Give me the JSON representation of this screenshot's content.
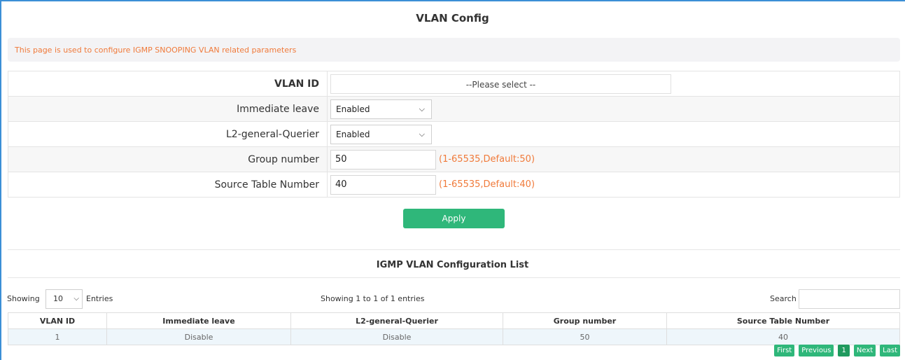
{
  "page": {
    "title": "VLAN Config",
    "notice": "This page is used to configure IGMP SNOOPING VLAN related parameters"
  },
  "form": {
    "vlan_id": {
      "label": "VLAN ID",
      "placeholder": "--Please select --"
    },
    "immediate_leave": {
      "label": "Immediate leave",
      "value": "Enabled"
    },
    "l2_general_querier": {
      "label": "L2-general-Querier",
      "value": "Enabled"
    },
    "group_number": {
      "label": "Group number",
      "value": "50",
      "hint": "(1-65535,Default:50)"
    },
    "source_table_number": {
      "label": "Source Table Number",
      "value": "40",
      "hint": "(1-65535,Default:40)"
    },
    "apply_label": "Apply"
  },
  "list": {
    "title": "IGMP VLAN Configuration List",
    "showing_label": "Showing",
    "entries_value": "10",
    "entries_label": "Entries",
    "info": "Showing 1 to 1 of 1 entries",
    "search_label": "Search",
    "columns": [
      "VLAN ID",
      "Immediate leave",
      "L2-general-Querier",
      "Group number",
      "Source Table Number"
    ],
    "rows": [
      [
        "1",
        "Disable",
        "Disable",
        "50",
        "40"
      ]
    ],
    "pager": {
      "first": "First",
      "previous": "Previous",
      "current": "1",
      "next": "Next",
      "last": "Last"
    }
  },
  "colors": {
    "accent_green": "#2fb77a",
    "hint_orange": "#f07a3a",
    "frame_blue": "#3b8fd6"
  },
  "icons": [
    "chevron-down-icon"
  ]
}
